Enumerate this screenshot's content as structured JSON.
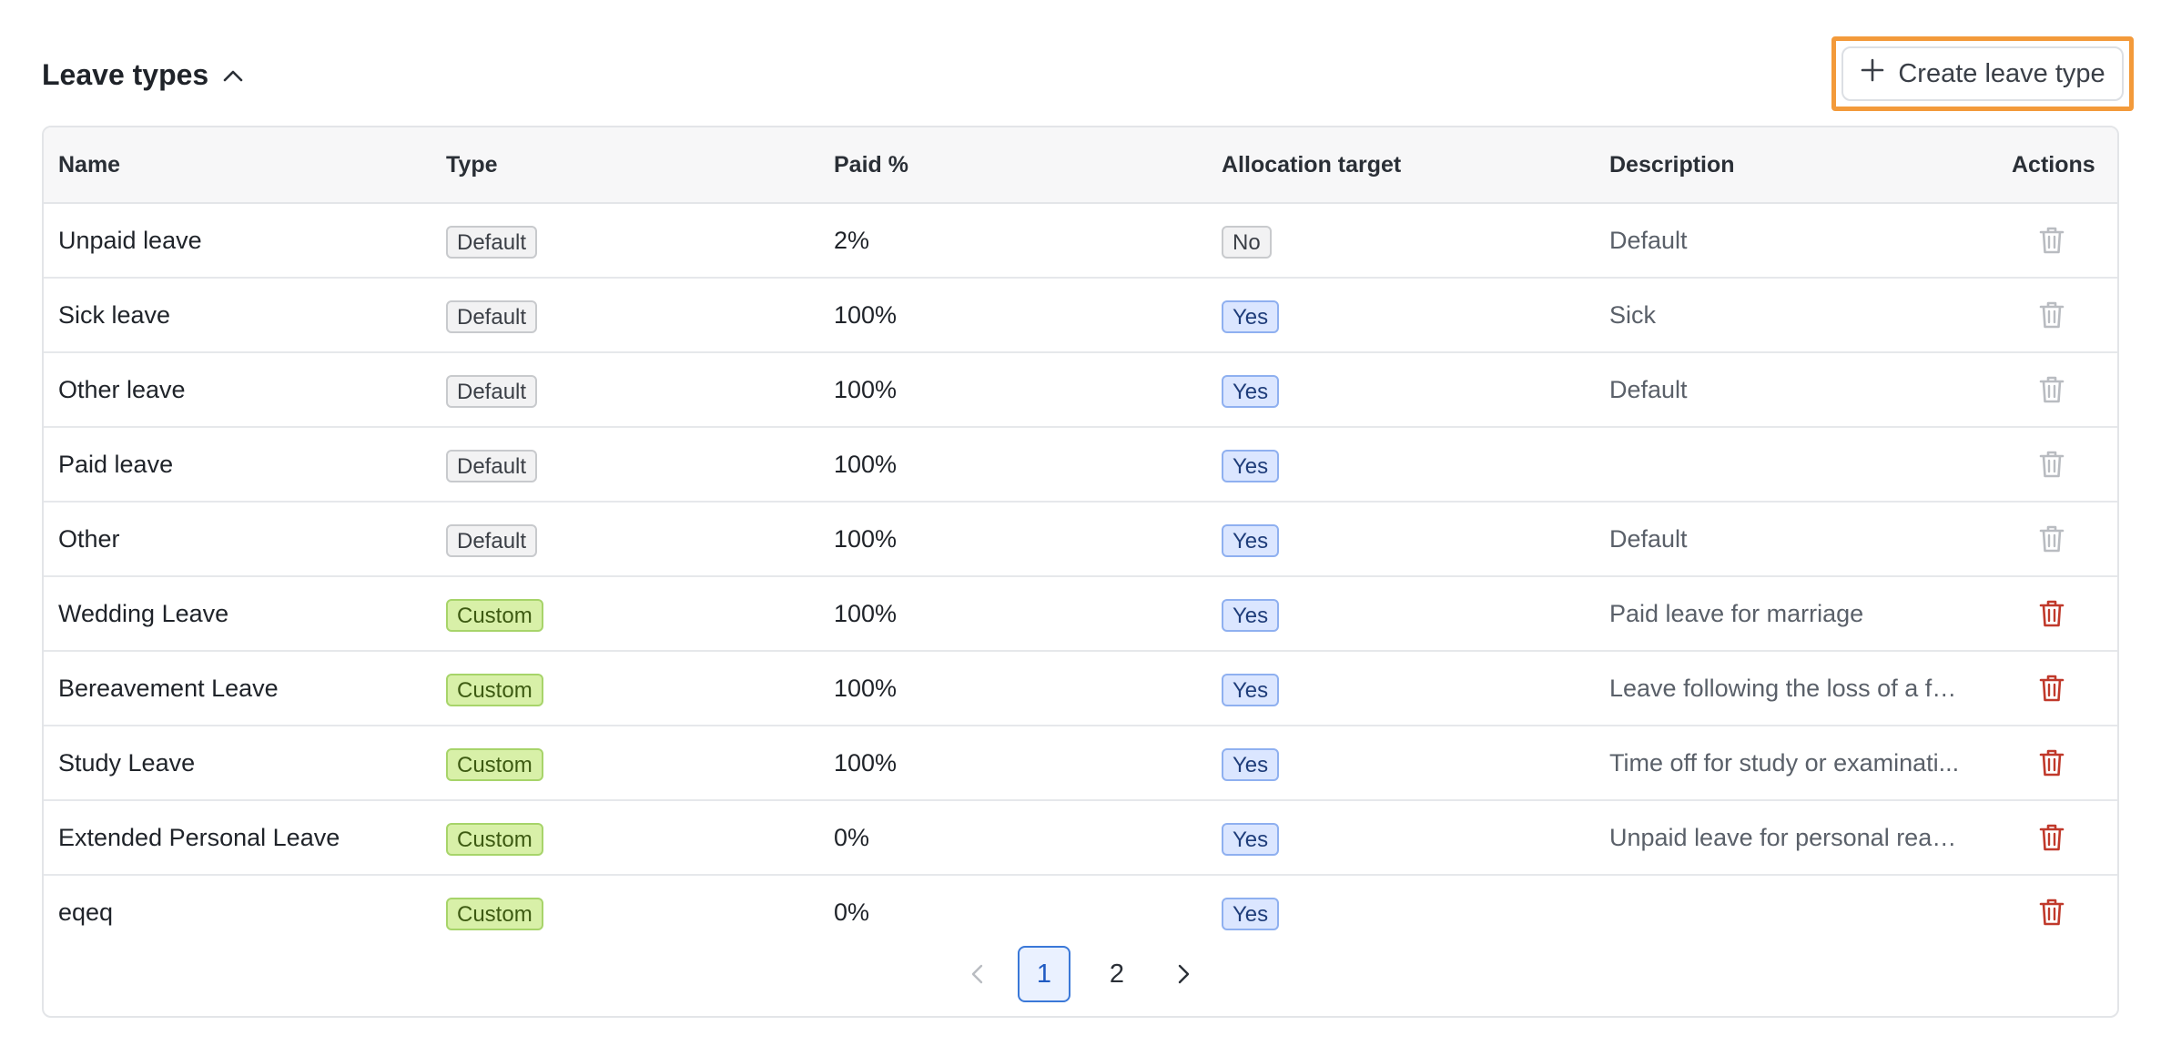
{
  "header": {
    "title": "Leave types",
    "create_label": "Create leave type"
  },
  "table": {
    "columns": [
      "Name",
      "Type",
      "Paid %",
      "Allocation target",
      "Description",
      "Actions"
    ],
    "rows": [
      {
        "name": "Unpaid leave",
        "type": "Default",
        "paid": "2%",
        "allocation": "No",
        "description": "Default",
        "deletable": false
      },
      {
        "name": "Sick leave",
        "type": "Default",
        "paid": "100%",
        "allocation": "Yes",
        "description": "Sick",
        "deletable": false
      },
      {
        "name": "Other leave",
        "type": "Default",
        "paid": "100%",
        "allocation": "Yes",
        "description": "Default",
        "deletable": false
      },
      {
        "name": "Paid leave",
        "type": "Default",
        "paid": "100%",
        "allocation": "Yes",
        "description": "",
        "deletable": false
      },
      {
        "name": "Other",
        "type": "Default",
        "paid": "100%",
        "allocation": "Yes",
        "description": "Default",
        "deletable": false
      },
      {
        "name": "Wedding Leave",
        "type": "Custom",
        "paid": "100%",
        "allocation": "Yes",
        "description": "Paid leave for marriage",
        "deletable": true
      },
      {
        "name": "Bereavement Leave",
        "type": "Custom",
        "paid": "100%",
        "allocation": "Yes",
        "description": "Leave following the loss of a fa...",
        "deletable": true
      },
      {
        "name": "Study Leave",
        "type": "Custom",
        "paid": "100%",
        "allocation": "Yes",
        "description": "Time off for study or examinati...",
        "deletable": true
      },
      {
        "name": "Extended Personal Leave",
        "type": "Custom",
        "paid": "0%",
        "allocation": "Yes",
        "description": "Unpaid leave for personal reas...",
        "deletable": true
      },
      {
        "name": "eqeq",
        "type": "Custom",
        "paid": "0%",
        "allocation": "Yes",
        "description": "",
        "deletable": true
      }
    ]
  },
  "pagination": {
    "pages": [
      "1",
      "2"
    ],
    "current": "1"
  },
  "colors": {
    "highlight_outline": "#f39a3a",
    "trash_enabled": "#c0392b",
    "trash_disabled": "#b9bcc1",
    "active_page": "#3a78d8"
  },
  "icons": {
    "collapse": "chevron-up-icon",
    "create": "plus-icon",
    "delete": "trash-icon",
    "prev": "chevron-left-icon",
    "next": "chevron-right-icon"
  }
}
